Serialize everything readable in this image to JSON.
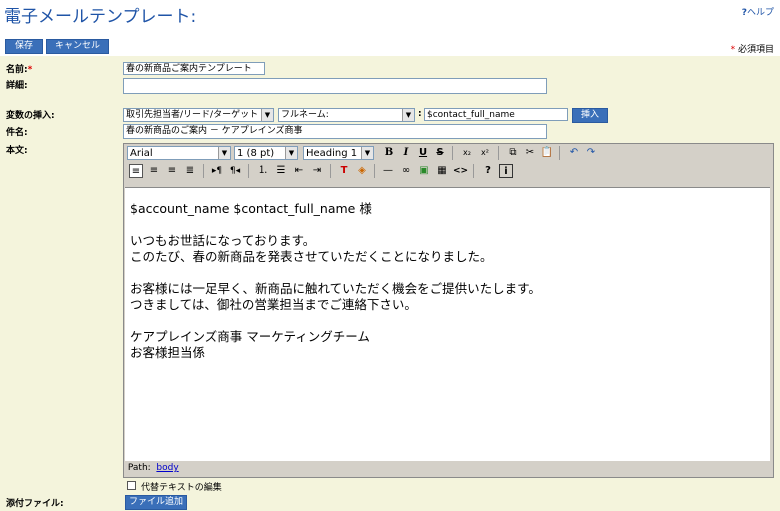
{
  "page": {
    "title": "電子メールテンプレート:",
    "help_icon": "?",
    "help_label": "ヘルプ"
  },
  "toolbar": {
    "save_label": "保存",
    "cancel_label": "キャンセル"
  },
  "required_note": {
    "mark": "*",
    "text": "必須項目"
  },
  "form": {
    "name": {
      "label": "名前:",
      "required_mark": "*",
      "value": "春の新商品ご案内テンプレート"
    },
    "description": {
      "label": "詳細:",
      "value": ""
    },
    "variables": {
      "label": "変数の挿入:",
      "object_select": "取引先担当者/リード/ターゲット",
      "field_select": "フルネーム:",
      "separator": ":",
      "variable_value": "$contact_full_name",
      "insert_button": "挿入"
    },
    "subject": {
      "label": "件名:",
      "value": "春の新商品のご案内 － ケアプレインズ商事"
    },
    "body": {
      "label": "本文:",
      "font_family": "Arial",
      "font_size": "1 (8 pt)",
      "format": "Heading 1",
      "tools": {
        "bold": "B",
        "italic": "I",
        "underline": "U",
        "strike": "S",
        "subscript": "x₂",
        "superscript": "x²",
        "help": "?",
        "info": "i"
      },
      "lines": [
        "",
        "$account_name  $contact_full_name 様",
        "",
        "いつもお世話になっております。",
        "このたび、春の新商品を発表させていただくことになりました。",
        "",
        "お客様には一足早く、新商品に触れていただく機会をご提供いたします。",
        "つきましては、御社の営業担当までご連絡下さい。",
        "",
        "ケアプレインズ商事 マーケティングチーム",
        "お客様担当係"
      ],
      "path_label": "Path:",
      "path_value": "body",
      "alt_text_label": "代替テキストの編集"
    },
    "attachments": {
      "label": "添付ファイル:",
      "add_button": "ファイル追加"
    }
  }
}
